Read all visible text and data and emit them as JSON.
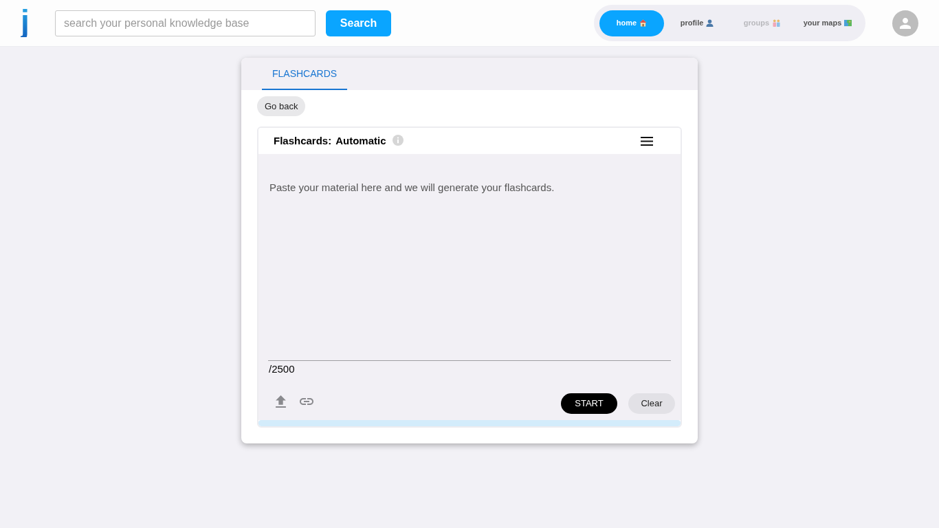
{
  "header": {
    "logo": "j",
    "search": {
      "placeholder": "search your personal knowledge base"
    },
    "search_button": "Search",
    "nav": [
      {
        "label": "home",
        "selected": true,
        "disabled": false
      },
      {
        "label": "profile",
        "selected": false,
        "disabled": false
      },
      {
        "label": "groups",
        "selected": false,
        "disabled": true
      },
      {
        "label": "your maps",
        "selected": false,
        "disabled": false
      }
    ]
  },
  "tabs": [
    {
      "label": "FLASHCARDS",
      "selected": true
    }
  ],
  "back_button": "Go back",
  "panel": {
    "title": "Flashcards:",
    "mode": "Automatic",
    "textarea": {
      "placeholder": "Paste your material here and we will generate your flashcards."
    },
    "counter": "/2500",
    "buttons": [
      {
        "label": "START",
        "kind": "primary"
      },
      {
        "label": "Clear",
        "kind": "secondary"
      }
    ],
    "progress": {
      "level": 0
    }
  }
}
